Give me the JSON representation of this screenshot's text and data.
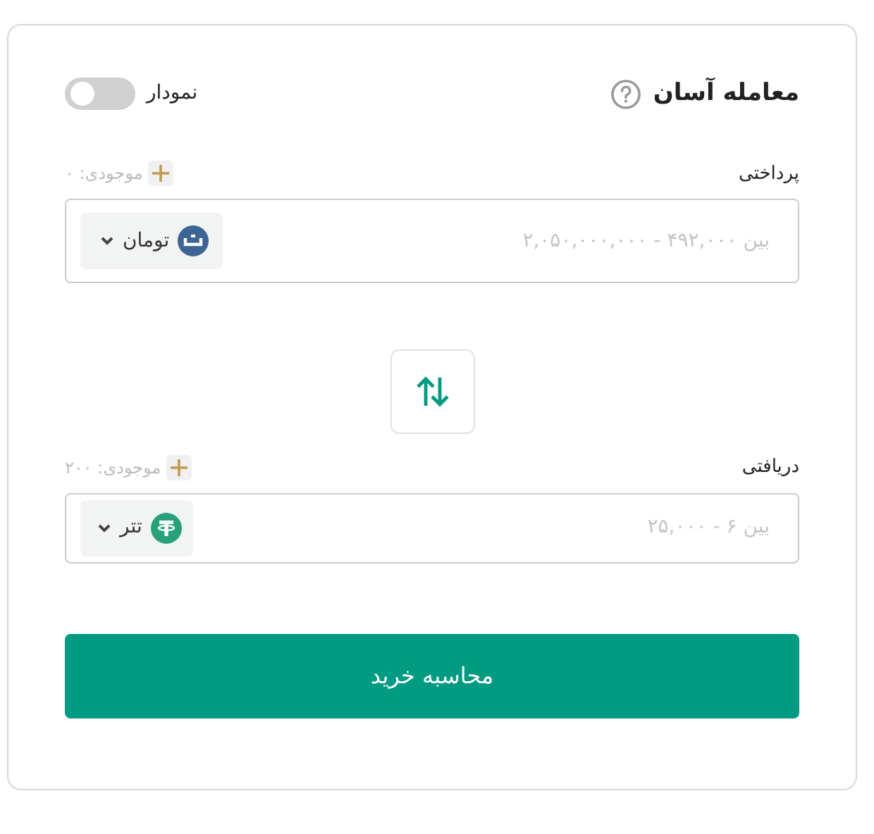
{
  "title": "معامله آسان",
  "chart_toggle": {
    "label": "نمودار",
    "on": false
  },
  "fields": [
    {
      "label": "پرداختی",
      "balance": "موجودی: ۰",
      "placeholder": "بین ۴۹۲,۰۰۰ - ۲,۰۵۰,۰۰۰,۰۰۰",
      "currency": "تومان",
      "kind": "toman"
    },
    {
      "label": "دریافتی",
      "balance": "موجودی: ۲۰۰",
      "placeholder": "بین ۶ - ۲۵,۰۰۰",
      "currency": "تتر",
      "kind": "tether"
    }
  ],
  "submit": "محاسبه خرید"
}
